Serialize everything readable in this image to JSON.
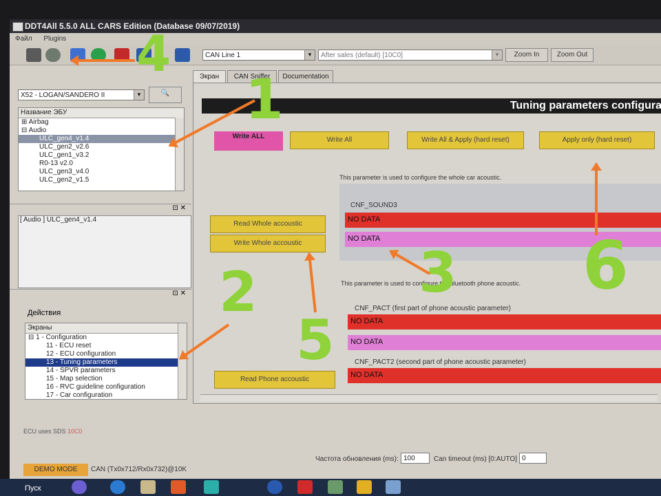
{
  "window": {
    "title": "DDT4All 5.5.0 ALL CARS Edition (Database 09/07/2019)",
    "menu": [
      "Файл",
      "Plugins"
    ]
  },
  "toolbar": {
    "can_combo": "CAN Line 1",
    "session_combo": "After sales (default) [10C0]",
    "zoom_in": "Zoom In",
    "zoom_out": "Zoom Out"
  },
  "tabs": [
    "Экран",
    "CAN Sniffer",
    "Documentation"
  ],
  "left": {
    "vehicle_combo": "X52 - LOGAN/SANDERO II",
    "ecu_header": "Название ЭБУ",
    "ecu_tree": [
      {
        "label": "⊞ Airbag",
        "level": 0
      },
      {
        "label": "⊟ Audio",
        "level": 0
      },
      {
        "label": "ULC_gen4_v1.4",
        "level": 1,
        "selected": true
      },
      {
        "label": "ULC_gen2_v2.6",
        "level": 1
      },
      {
        "label": "ULC_gen1_v3.2",
        "level": 1
      },
      {
        "label": "R0-13 v2.0",
        "level": 1
      },
      {
        "label": "ULC_gen3_v4.0",
        "level": 1
      },
      {
        "label": "ULC_gen2_v1.5",
        "level": 1
      }
    ],
    "loaded_ecu": "[ Audio ] ULC_gen4_v1.4",
    "actions_label": "Действия",
    "screens_header": "Экраны",
    "screens_tree": [
      {
        "label": "⊟ 1 - Configuration",
        "level": 0
      },
      {
        "label": "11 - ECU reset",
        "level": 1
      },
      {
        "label": "12 - ECU configuration",
        "level": 1
      },
      {
        "label": "13 - Tuning parameters",
        "level": 1,
        "selected": true
      },
      {
        "label": "14 - SPVR parameters",
        "level": 1
      },
      {
        "label": "15 - Map selection",
        "level": 1
      },
      {
        "label": "16 - RVC guideline configuration",
        "level": 1
      },
      {
        "label": "17 - Car configuration",
        "level": 1
      }
    ]
  },
  "screen": {
    "title": "Tuning parameters configura",
    "write_all_label": "Write ALL",
    "buttons": {
      "write_all": "Write All",
      "write_all_apply": "Write All & Apply (hard reset)",
      "apply_only": "Apply only (hard reset)",
      "read_whole": "Read Whole accoustic",
      "write_whole": "Write Whole accoustic",
      "read_phone": "Read Phone accoustic"
    },
    "group1": {
      "desc": "This parameter is used to configure the whole car acoustic.",
      "param": "CNF_SOUND3",
      "values": [
        "NO DATA",
        "NO DATA"
      ]
    },
    "group2": {
      "desc": "This parameter is used to configure the bluetooth phone acoustic.",
      "param1": "CNF_PACT (first part of phone acoustic parameter)",
      "param2": "CNF_PACT2 (second part of phone acoustic parameter)",
      "values": [
        "NO DATA",
        "NO DATA",
        "NO DATA"
      ]
    }
  },
  "status": {
    "log": "ECU uses SDS",
    "log_code": "10C0",
    "demo_mode": "DEMO MODE",
    "can_info": "CAN (Tx0x712/Rx0x732)@10K",
    "refresh_label": "Частота обновления (ms):",
    "refresh_value": "100",
    "timeout_label": "Can timeout (ms) [0:AUTO] :",
    "timeout_value": "0"
  },
  "taskbar": {
    "start": "Пуск"
  },
  "annotations": [
    "1",
    "2",
    "3",
    "4",
    "5",
    "6"
  ],
  "colors": {
    "yellow_button": "#e3c53a",
    "pink_button": "#e055a8",
    "red_value": "#e0302a",
    "pink_value": "#df7fd6",
    "annotation_number": "#8fd23a",
    "annotation_arrow": "#f07a2a"
  }
}
